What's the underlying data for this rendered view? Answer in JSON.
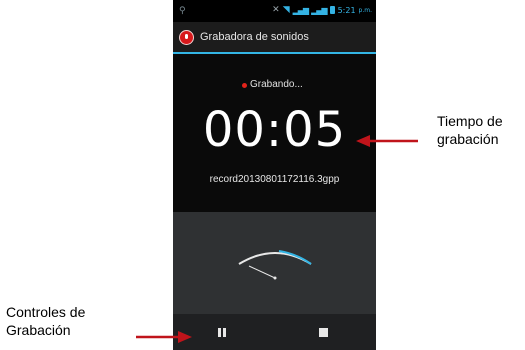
{
  "status_bar": {
    "time": "5:21",
    "ampm": "p.m."
  },
  "app": {
    "title": "Grabadora de sonidos"
  },
  "recording": {
    "status": "Grabando...",
    "elapsed": "00:05",
    "filename": "record20130801172116.3gpp"
  },
  "callouts": {
    "time_label_line1": "Tiempo de",
    "time_label_line2": "grabación",
    "controls_label_line1": "Controles de",
    "controls_label_line2": "Grabación"
  },
  "colors": {
    "accent": "#33b5e5",
    "record_red": "#e2231a",
    "arrow_red": "#c0141b"
  },
  "icons": {
    "app": "microphone-record-icon",
    "pause": "pause-icon",
    "stop": "stop-icon"
  }
}
